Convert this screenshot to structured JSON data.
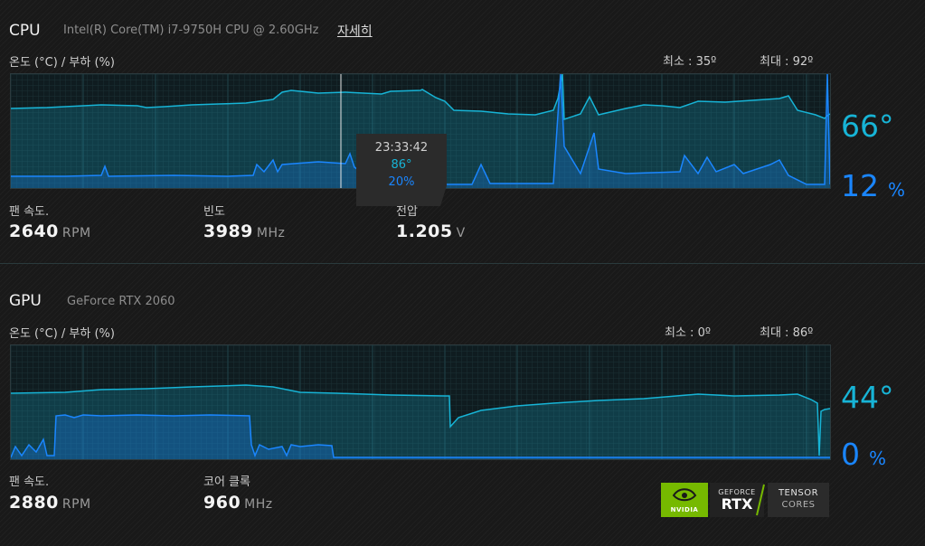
{
  "cpu": {
    "title": "CPU",
    "name": "Intel(R) Core(TM) i7-9750H CPU @ 2.60GHz",
    "detail_link": "자세히",
    "axis_label": "온도 (°C) / 부하 (%)",
    "min_label": "최소 : 35º",
    "max_label": "최대 : 92º",
    "current_temp": "66°",
    "current_load": "12",
    "load_unit": "%",
    "tooltip": {
      "time": "23:33:42",
      "temp": "86°",
      "load": "20%"
    },
    "stats": [
      {
        "label": "팬 속도.",
        "value": "2640",
        "unit": "RPM"
      },
      {
        "label": "빈도",
        "value": "3989",
        "unit": "MHz"
      },
      {
        "label": "전압",
        "value": "1.205",
        "unit": "V"
      }
    ]
  },
  "gpu": {
    "title": "GPU",
    "name": "GeForce RTX 2060",
    "axis_label": "온도 (°C) / 부하 (%)",
    "min_label": "최소 : 0º",
    "max_label": "최대 : 86º",
    "current_temp": "44°",
    "current_load": "0",
    "load_unit": "%",
    "stats": [
      {
        "label": "팬 속도.",
        "value": "2880",
        "unit": "RPM"
      },
      {
        "label": "코어 클록",
        "value": "960",
        "unit": "MHz"
      }
    ]
  },
  "badges": {
    "nvidia": "NVIDIA",
    "geforce": "GEFORCE",
    "rtx": "RTX",
    "tensor": "TENSOR",
    "cores": "CORES"
  },
  "colors": {
    "temp_line": "#17b4d6",
    "load_line": "#1a86ff"
  }
}
